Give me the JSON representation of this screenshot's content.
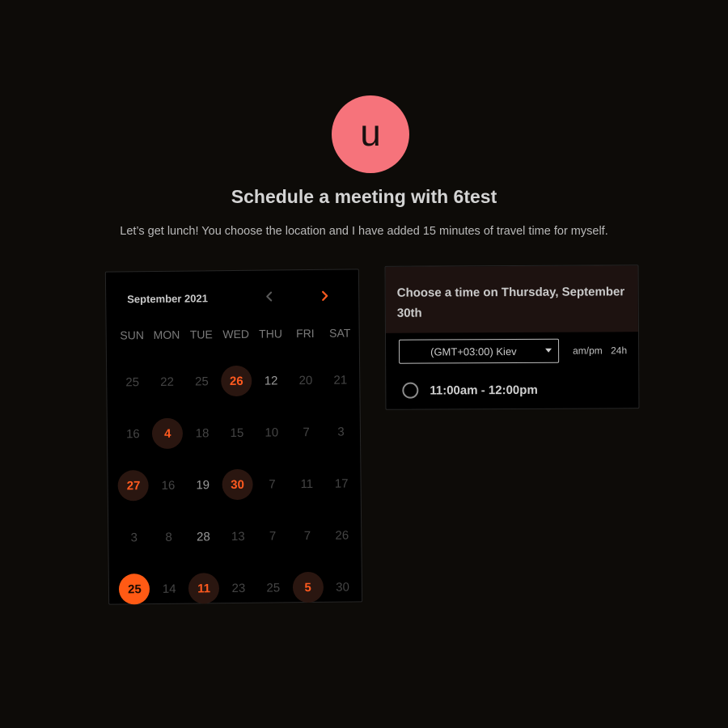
{
  "avatar": {
    "letter": "u",
    "color": "#f6737b"
  },
  "title": "Schedule a meeting with 6test",
  "subtitle": "Let’s get lunch! You choose the location and I have added 15 minutes of travel time for myself.",
  "calendar": {
    "month_label": "September 2021",
    "prev_icon": "chevron-left-icon",
    "next_icon": "chevron-right-icon",
    "accent": "#ff5a1f",
    "weekdays": [
      "SUN",
      "MON",
      "TUE",
      "WED",
      "THU",
      "FRI",
      "SAT"
    ],
    "days": [
      {
        "label": "25",
        "state": "muted"
      },
      {
        "label": "22",
        "state": "muted"
      },
      {
        "label": "25",
        "state": "muted"
      },
      {
        "label": "26",
        "state": "available"
      },
      {
        "label": "12",
        "state": "bright"
      },
      {
        "label": "20",
        "state": "muted"
      },
      {
        "label": "21",
        "state": "muted"
      },
      {
        "label": "16",
        "state": "muted"
      },
      {
        "label": "4",
        "state": "available"
      },
      {
        "label": "18",
        "state": "muted"
      },
      {
        "label": "15",
        "state": "muted"
      },
      {
        "label": "10",
        "state": "muted"
      },
      {
        "label": "7",
        "state": "muted"
      },
      {
        "label": "3",
        "state": "muted"
      },
      {
        "label": "27",
        "state": "available"
      },
      {
        "label": "16",
        "state": "muted"
      },
      {
        "label": "19",
        "state": "bright"
      },
      {
        "label": "30",
        "state": "available"
      },
      {
        "label": "7",
        "state": "muted"
      },
      {
        "label": "11",
        "state": "muted"
      },
      {
        "label": "17",
        "state": "muted"
      },
      {
        "label": "3",
        "state": "muted"
      },
      {
        "label": "8",
        "state": "muted"
      },
      {
        "label": "28",
        "state": "bright"
      },
      {
        "label": "13",
        "state": "muted"
      },
      {
        "label": "7",
        "state": "muted"
      },
      {
        "label": "7",
        "state": "muted"
      },
      {
        "label": "26",
        "state": "muted"
      },
      {
        "label": "25",
        "state": "selected"
      },
      {
        "label": "14",
        "state": "muted"
      },
      {
        "label": "11",
        "state": "available"
      },
      {
        "label": "23",
        "state": "muted"
      },
      {
        "label": "25",
        "state": "muted"
      },
      {
        "label": "5",
        "state": "available"
      },
      {
        "label": "30",
        "state": "muted"
      }
    ]
  },
  "time_panel": {
    "heading": "Choose a time on Thursday, September 30th",
    "timezone": "(GMT+03:00) Kiev",
    "format_ampm": "am/pm",
    "format_24h": "24h",
    "slots": [
      "11:00am - 12:00pm"
    ]
  }
}
